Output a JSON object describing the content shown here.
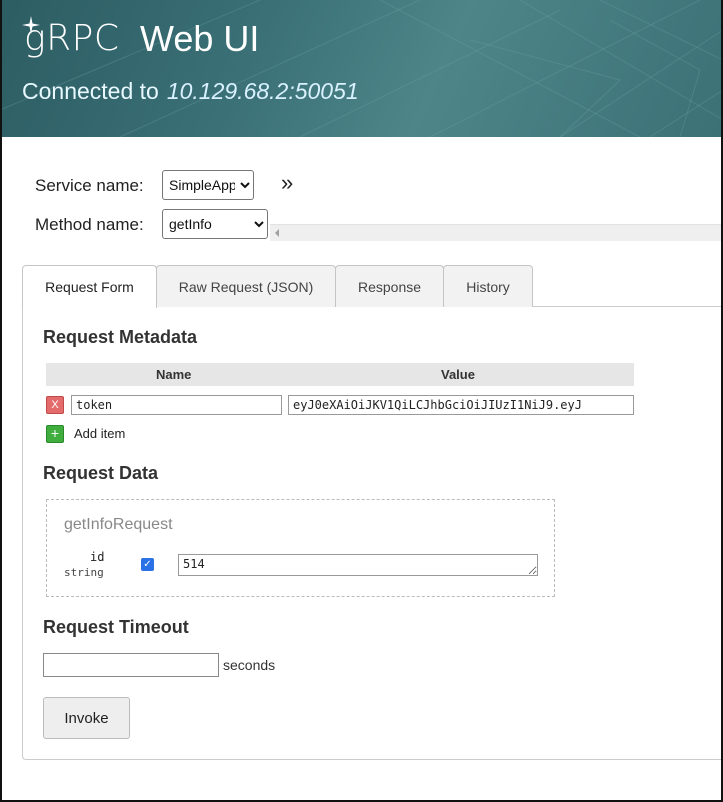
{
  "header": {
    "logo": "gRPC",
    "title": "Web UI",
    "connected_label": "Connected to",
    "address": "10.129.68.2:50051"
  },
  "service": {
    "label": "Service name:",
    "selected": "SimpleApp"
  },
  "method": {
    "label": "Method name:",
    "selected": "getInfo"
  },
  "expand_symbol": "»",
  "tabs": [
    {
      "label": "Request Form",
      "active": true
    },
    {
      "label": "Raw Request (JSON)",
      "active": false
    },
    {
      "label": "Response",
      "active": false
    },
    {
      "label": "History",
      "active": false
    }
  ],
  "metadata": {
    "heading": "Request Metadata",
    "col_name": "Name",
    "col_value": "Value",
    "rows": [
      {
        "remove_symbol": "X",
        "name": "token",
        "value": "eyJ0eXAiOiJKV1QiLCJhbGciOiJIUzI1NiJ9.eyJ"
      }
    ],
    "add_symbol": "+",
    "add_label": "Add item"
  },
  "request_data": {
    "heading": "Request Data",
    "message": "getInfoRequest",
    "field": {
      "name": "id",
      "type": "string",
      "checked": true,
      "value": "514"
    }
  },
  "timeout": {
    "heading": "Request Timeout",
    "value": "",
    "unit": "seconds"
  },
  "invoke_label": "Invoke",
  "colors": {
    "header": "#3a7076",
    "remove": "#e36b6b",
    "add": "#3fae3f",
    "checkbox": "#2b72e6"
  }
}
